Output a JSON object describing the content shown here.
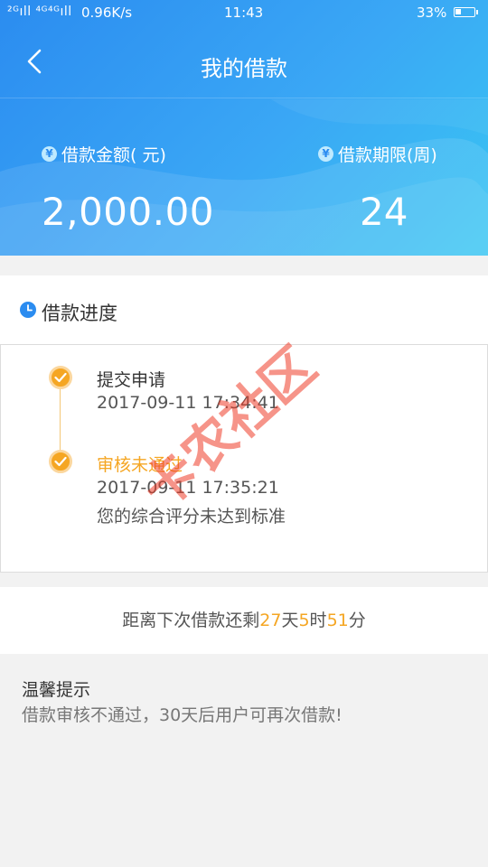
{
  "status_bar": {
    "signal": "²ᴳıll ⁴ᴳ⁴ᴳıll",
    "speed": "0.96K/s",
    "time": "11:43",
    "battery_pct": "33%",
    "battery_level": 0.33
  },
  "header": {
    "title": "我的借款",
    "back_icon": "chevron-left-icon"
  },
  "summary": {
    "amount_label": "借款金额( 元)",
    "amount_value": "2,000.00",
    "term_label": "借款期限(周)",
    "term_value": "24",
    "yen_symbol": "¥"
  },
  "progress": {
    "title": "借款进度",
    "steps": [
      {
        "title": "提交申请",
        "time": "2017-09-11 17:34:41"
      },
      {
        "title": "审核未通过",
        "time": "2017-09-11 17:35:21",
        "note": "您的综合评分未达到标准"
      }
    ]
  },
  "countdown": {
    "prefix": "距离下次借款还剩",
    "days": "27",
    "days_unit": "天",
    "hours": "5",
    "hours_unit": "时",
    "minutes": "51",
    "minutes_unit": "分"
  },
  "tips": {
    "title": "温馨提示",
    "body": "借款审核不通过，30天后用户可再次借款!"
  },
  "watermark": "卡农社区",
  "colors": {
    "brand_blue": "#2b8cf0",
    "accent_orange": "#f5a623",
    "failed_text": "#f5a623",
    "watermark_red": "#ee3c28"
  }
}
